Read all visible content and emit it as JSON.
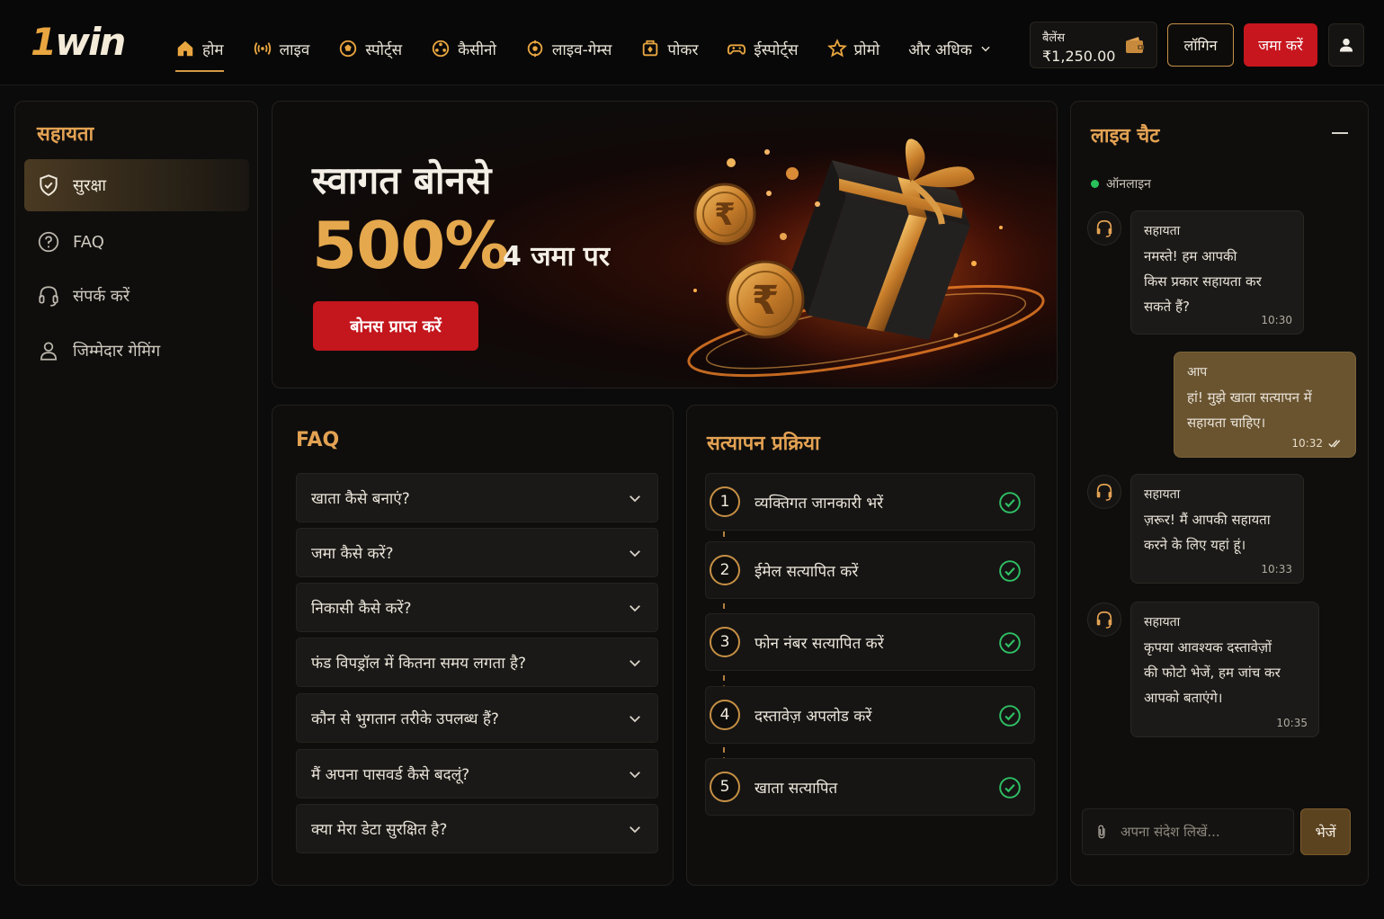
{
  "header": {
    "logo": {
      "one": "1",
      "rest": "win"
    },
    "nav": [
      {
        "label": "होम",
        "icon": "home-icon"
      },
      {
        "label": "लाइव",
        "icon": "live-icon"
      },
      {
        "label": "स्पोर्ट्स",
        "icon": "soccer-ball-icon"
      },
      {
        "label": "कैसीनो",
        "icon": "casino-chip-icon"
      },
      {
        "label": "लाइव-गेम्स",
        "icon": "live-games-icon"
      },
      {
        "label": "पोकर",
        "icon": "poker-icon"
      },
      {
        "label": "ईस्पोर्ट्स",
        "icon": "gamepad-icon"
      },
      {
        "label": "प्रोमो",
        "icon": "star-icon"
      },
      {
        "label": "और अधिक",
        "icon": "chevron-down-icon"
      }
    ],
    "balance_label": "बैलेंस",
    "balance_value": "₹1,250.00",
    "login_label": "लॉगिन",
    "deposit_label": "जमा करें"
  },
  "sidebar": {
    "title": "सहायता",
    "items": [
      {
        "label": "सुरक्षा",
        "icon": "shield-icon"
      },
      {
        "label": "FAQ",
        "icon": "question-circle-icon"
      },
      {
        "label": "संपर्क करें",
        "icon": "headset-icon"
      },
      {
        "label": "जिम्मेदार गेमिंग",
        "icon": "user-icon"
      }
    ]
  },
  "hero": {
    "title": "स्वागत बोनसे",
    "big": "500%",
    "sub": "4 जमा पर",
    "button": "बोनस प्राप्त करें"
  },
  "faq": {
    "title": "FAQ",
    "items": [
      "खाता कैसे बनाएं?",
      "जमा कैसे करें?",
      "निकासी कैसे करें?",
      "फंड विपड्रॉल में कितना समय लगता है?",
      "कौन से भुगतान तरीके उपलब्ध हैं?",
      "मैं अपना पासवर्ड कैसे बदलूं?",
      "क्या मेरा डेटा सुरक्षित है?"
    ]
  },
  "verify": {
    "title": "सत्यापन प्रक्रिया",
    "steps": [
      {
        "num": "1",
        "label": "व्यक्तिगत जानकारी भरें"
      },
      {
        "num": "2",
        "label": "ईमेल सत्यापित करें"
      },
      {
        "num": "3",
        "label": "फोन नंबर सत्यापित करें"
      },
      {
        "num": "4",
        "label": "दस्तावेज़ अपलोड करें"
      },
      {
        "num": "5",
        "label": "खाता सत्यापित"
      }
    ]
  },
  "chat": {
    "title": "लाइव चैट",
    "status": "ऑनलाइन",
    "messages": [
      {
        "who": "सहायता",
        "lines": [
          "नमस्ते! हम आपकी",
          "किस प्रकार सहायता कर",
          "सकते हैं?"
        ],
        "time": "10:30"
      },
      {
        "who": "आप",
        "lines": [
          "हां! मुझे खाता सत्यापन में",
          "सहायता चाहिए।"
        ],
        "time": "10:32"
      },
      {
        "who": "सहायता",
        "lines": [
          "ज़रूर! मैं आपकी सहायता",
          "करने के लिए यहां हूं।"
        ],
        "time": "10:33"
      },
      {
        "who": "सहायता",
        "lines": [
          "कृपया आवश्यक दस्तावेज़ों",
          "की फोटो भेजें, हम जांच कर",
          "आपको बताएंगे।"
        ],
        "time": "10:35"
      }
    ],
    "input_placeholder": "अपना संदेश लिखें...",
    "send_label": "भेजें"
  },
  "colors": {
    "accent": "#e3a253",
    "brand_red": "#c8161e",
    "online": "#28c15a"
  }
}
